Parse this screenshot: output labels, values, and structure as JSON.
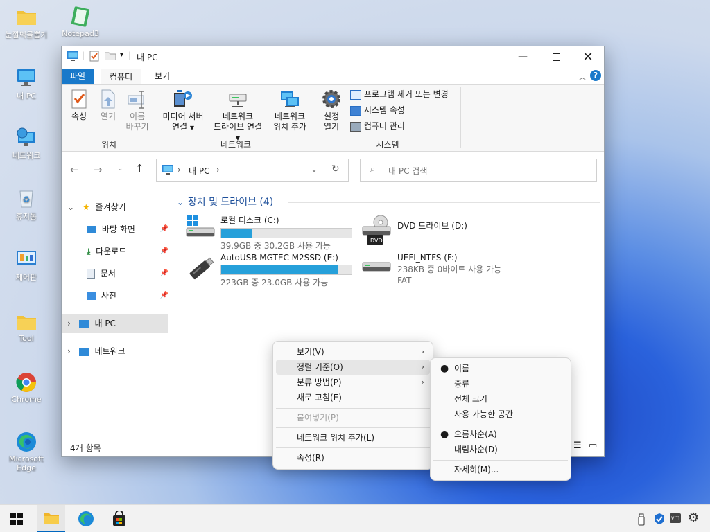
{
  "desktop": {
    "icons": [
      {
        "label": "눈깔먹물뽑기"
      },
      {
        "label": "Notepad3"
      },
      {
        "label": "내 PC"
      },
      {
        "label": "네트워크"
      },
      {
        "label": "휴지통"
      },
      {
        "label": "제어판"
      },
      {
        "label": "Tool"
      },
      {
        "label": "Chrome"
      },
      {
        "label": "Microsoft Edge"
      }
    ]
  },
  "window": {
    "title": "내 PC",
    "ribbon_tabs": [
      "파일",
      "컴퓨터",
      "보기"
    ],
    "ribbon": {
      "location_group": "위치",
      "network_group": "네트워크",
      "system_group": "시스템",
      "properties": "속성",
      "open": "열기",
      "rename_1": "이름",
      "rename_2": "바꾸기",
      "media_server_1": "미디어 서버",
      "media_server_2": "연결",
      "map_drive_1": "네트워크",
      "map_drive_2": "드라이브 연결",
      "add_location_1": "네트워크",
      "add_location_2": "위치 추가",
      "settings_1": "설정",
      "settings_2": "열기",
      "uninstall": "프로그램 제거 또는 변경",
      "system_properties": "시스템 속성",
      "computer_management": "컴퓨터 관리"
    },
    "address": {
      "crumb": "내 PC"
    },
    "search": {
      "placeholder": "내 PC 검색"
    },
    "nav": {
      "quick_access": "즐겨찾기",
      "desktop": "바탕 화면",
      "downloads": "다운로드",
      "documents": "문서",
      "pictures": "사진",
      "this_pc": "내 PC",
      "network": "네트워크"
    },
    "section": {
      "title": "장치 및 드라이브 (4)"
    },
    "drives": [
      {
        "name": "로컬 디스크 (C:)",
        "info": "39.9GB 중 30.2GB 사용 가능",
        "used_fraction": 0.24
      },
      {
        "name": "DVD 드라이브 (D:)",
        "badge": "DVD"
      },
      {
        "name": "AutoUSB MGTEC M2SSD (E:)",
        "info": "223GB 중 23.0GB 사용 가능",
        "used_fraction": 0.9
      },
      {
        "name": "UEFI_NTFS (F:)",
        "info": "238KB 중 0바이트 사용 가능",
        "fs": "FAT"
      }
    ],
    "status": {
      "count": "4개 항목"
    }
  },
  "context_menu": {
    "items": [
      "보기(V)",
      "정렬 기준(O)",
      "분류 방법(P)",
      "새로 고침(E)",
      "붙여넣기(P)",
      "네트워크 위치 추가(L)",
      "속성(R)"
    ]
  },
  "sort_submenu": {
    "items": [
      "이름",
      "종류",
      "전체 크기",
      "사용 가능한 공간",
      "오름차순(A)",
      "내림차순(D)",
      "자세히(M)..."
    ]
  },
  "colors": {
    "accent": "#0067c0",
    "bar_fill": "#26a0da",
    "selection": "#e3e3e3"
  },
  "icons": [
    "windows-start-icon",
    "file-explorer-icon",
    "edge-icon",
    "store-icon",
    "usb-icon",
    "defender-icon",
    "vm-icon",
    "gear-icon"
  ]
}
